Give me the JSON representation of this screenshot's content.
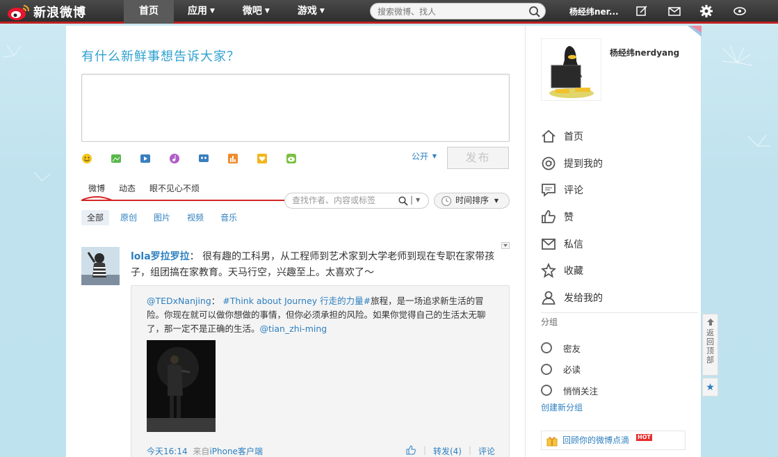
{
  "topnav": {
    "logo": "新浪微博",
    "items": [
      "首页",
      "应用",
      "微吧",
      "游戏"
    ],
    "search_placeholder": "搜索微博、找人",
    "user": "杨经纬ner..."
  },
  "publish": {
    "title": "有什么新鲜事想告诉大家？",
    "visibility": "公开",
    "post_label": "发布"
  },
  "feed_tabs": [
    "微博",
    "动态",
    "眼不见心不烦"
  ],
  "filter": {
    "placeholder": "查找作者、内容或标签",
    "sort_label": "时间排序"
  },
  "subtabs": [
    "全部",
    "原创",
    "图片",
    "视频",
    "音乐"
  ],
  "post": {
    "author": "lola罗拉罗拉",
    "colon": "：",
    "text": "很有趣的工科男，从工程师到艺术家到大学老师到现在专职在家带孩子，组团搞在家教育。天马行空，兴趣至上。太喜欢了～",
    "repost_author": "@TEDxNanjing",
    "repost_colon": "：",
    "repost_tag": "#Think about Journey 行走的力量#",
    "repost_text": "旅程，是一场追求新生活的冒险。你现在就可以做你想做的事情，但你必须承担的风险。如果你觉得自己的生活太无聊了，那一定不是正确的生活。",
    "repost_mention": "@tian_zhi-ming",
    "time": "今天16:14",
    "source_prefix": "来自",
    "source": "iPhone客户端",
    "repost_count": "转发(4)",
    "comment": "评论"
  },
  "sidebar": {
    "username": "杨经纬nerdyang",
    "nav": [
      "首页",
      "提到我的",
      "评论",
      "赞",
      "私信",
      "收藏",
      "发给我的"
    ],
    "group_title": "分组",
    "groups": [
      "密友",
      "必读",
      "悄悄关注"
    ],
    "create_group": "创建新分组",
    "review": "回顾你的微博点滴",
    "hot_badge": "HOT"
  },
  "backtop": "返回顶部",
  "colors": {
    "accent_blue": "#2c7fc0",
    "nav_red": "#c11f1f",
    "title_blue": "#2fa0d0"
  }
}
